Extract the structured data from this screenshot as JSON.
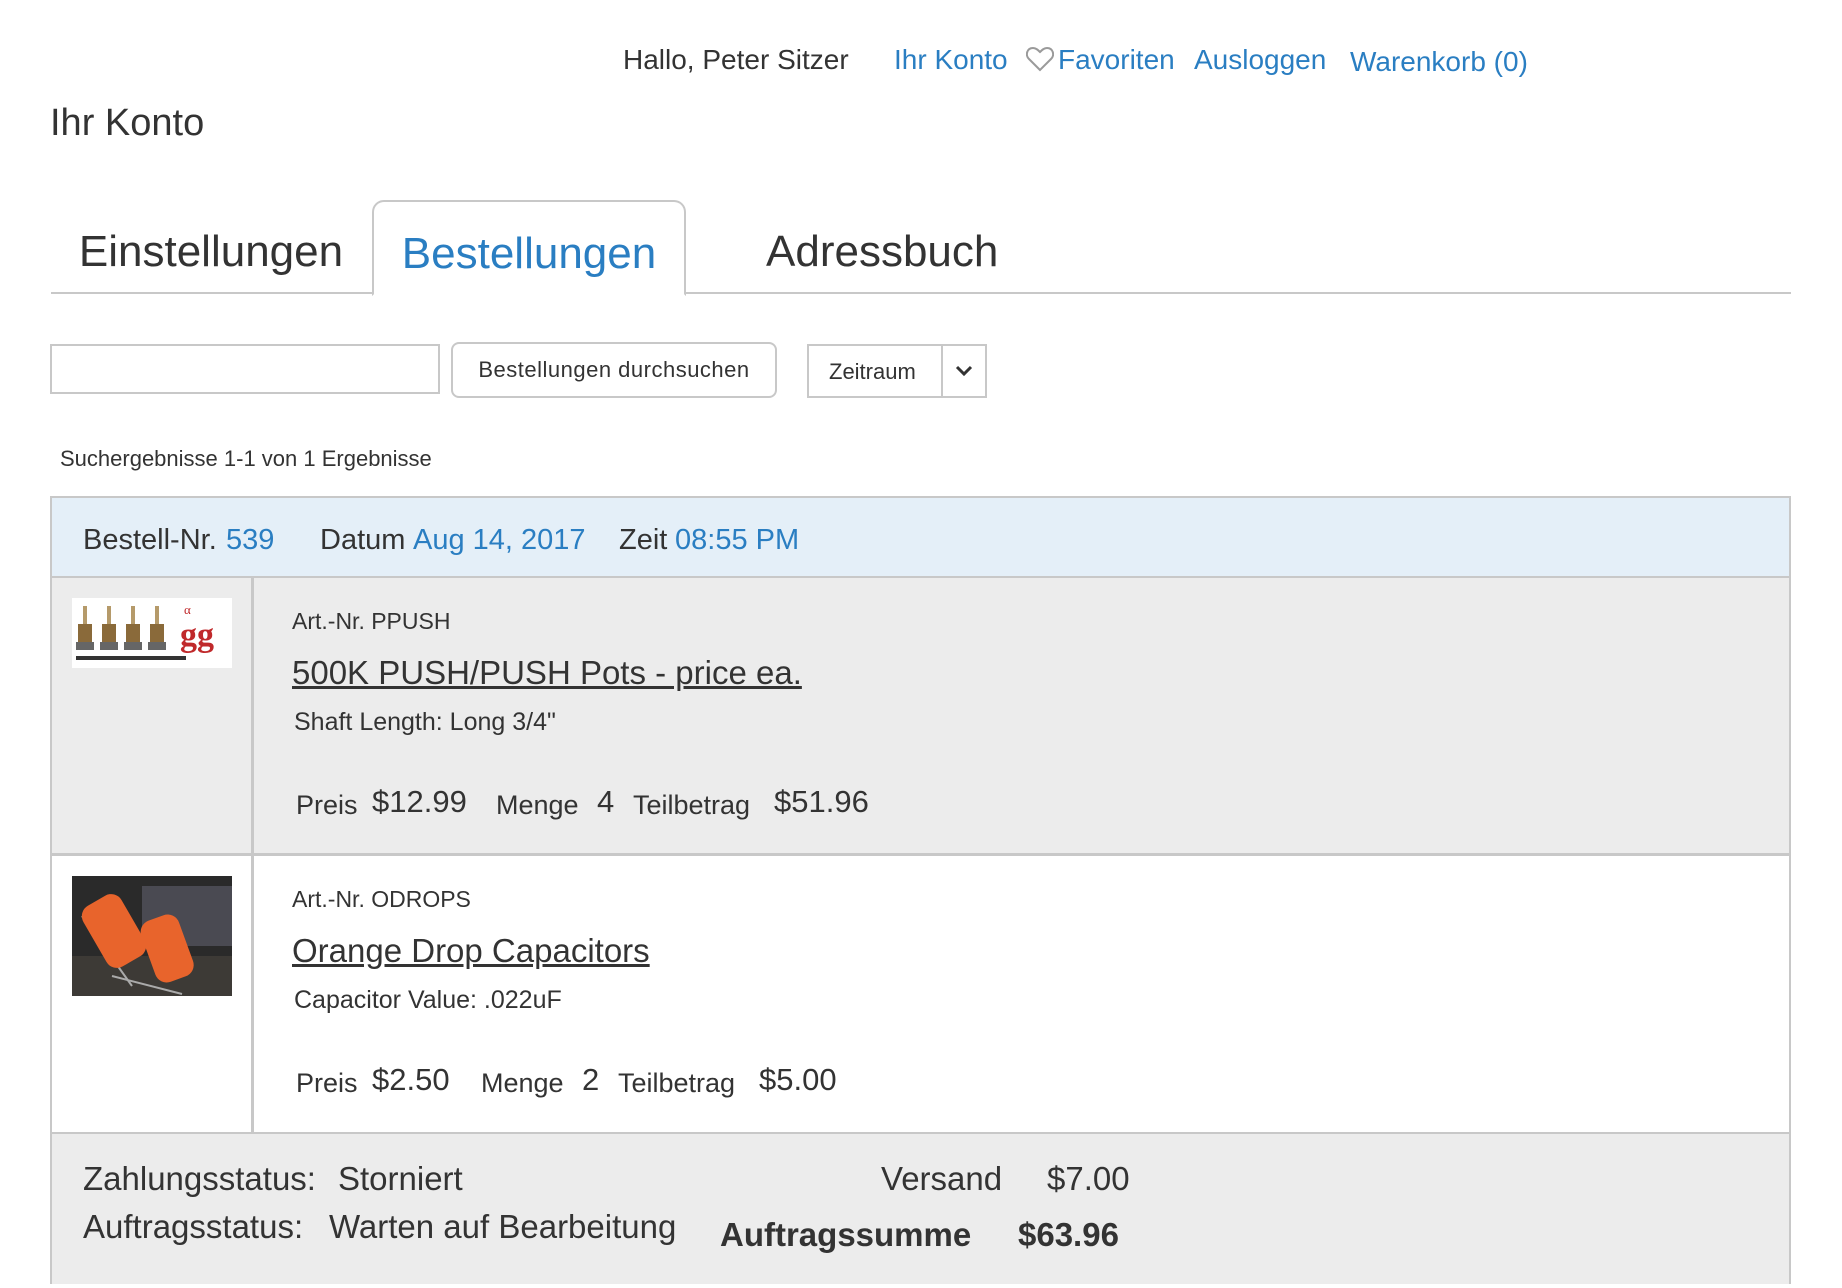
{
  "header": {
    "greeting": "Hallo, Peter Sitzer",
    "account_link": "Ihr Konto",
    "favorites_link": "Favoriten",
    "logout_link": "Ausloggen",
    "cart_link": "Warenkorb (0)"
  },
  "page_title": "Ihr Konto",
  "tabs": [
    {
      "label": "Einstellungen",
      "active": false
    },
    {
      "label": "Bestellungen",
      "active": true
    },
    {
      "label": "Adressbuch",
      "active": false
    }
  ],
  "search": {
    "value": "",
    "button_label": "Bestellungen durchsuchen",
    "period_select": "Zeitraum"
  },
  "results_text": "Suchergebnisse 1-1 von 1 Ergebnisse",
  "order": {
    "number_label": "Bestell-Nr.",
    "number": "539",
    "date_label": "Datum",
    "date": "Aug 14, 2017",
    "time_label": "Zeit",
    "time": "08:55 PM",
    "items": [
      {
        "sku": "Art.-Nr. PPUSH",
        "name": "500K PUSH/PUSH Pots - price ea.",
        "option": "Shaft Length: Long 3/4\"",
        "price_label": "Preis",
        "price": "$12.99",
        "qty_label": "Menge",
        "qty": "4",
        "subtotal_label": "Teilbetrag",
        "subtotal": "$51.96"
      },
      {
        "sku": "Art.-Nr. ODROPS",
        "name": "Orange Drop Capacitors",
        "option": "Capacitor Value: .022uF",
        "price_label": "Preis",
        "price": "$2.50",
        "qty_label": "Menge",
        "qty": "2",
        "subtotal_label": "Teilbetrag",
        "subtotal": "$5.00"
      }
    ],
    "payment_status_label": "Zahlungsstatus:",
    "payment_status": "Storniert",
    "order_status_label": "Auftragsstatus:",
    "order_status": "Warten auf Bearbeitung",
    "shipping_label": "Versand",
    "shipping": "$7.00",
    "total_label": "Auftragssumme",
    "total": "$63.96"
  },
  "colors": {
    "link_blue": "#2a7ec2",
    "status_green": "#1b8a78",
    "header_bg": "#e4eff8",
    "item_bg": "#ececec"
  }
}
